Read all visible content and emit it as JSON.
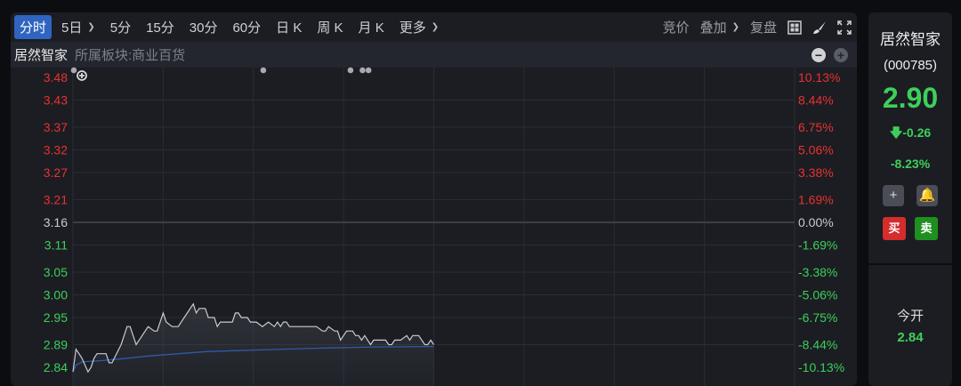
{
  "toolbar": {
    "tabs": [
      "分时",
      "5日",
      "5分",
      "15分",
      "30分",
      "60分",
      "日 K",
      "周 K",
      "月 K",
      "更多"
    ],
    "right": {
      "auction": "竞价",
      "overlay": "叠加",
      "replay": "复盘"
    }
  },
  "subheader": {
    "name": "居然智家",
    "sector": "所属板块:商业百货"
  },
  "axes": {
    "left": [
      "3.48",
      "3.43",
      "3.37",
      "3.32",
      "3.27",
      "3.21",
      "3.16",
      "3.11",
      "3.05",
      "3.00",
      "2.95",
      "2.89",
      "2.84"
    ],
    "right": [
      "10.13%",
      "8.44%",
      "6.75%",
      "5.06%",
      "3.38%",
      "1.69%",
      "0.00%",
      "-1.69%",
      "-3.38%",
      "-5.06%",
      "-6.75%",
      "-8.44%",
      "-10.13%"
    ]
  },
  "chart_data": {
    "type": "line",
    "prev_close": 3.16,
    "ylim": [
      2.84,
      3.48
    ],
    "xlim_minutes": [
      0,
      240
    ],
    "series": [
      {
        "name": "price",
        "color": "#c9cbd0",
        "points": [
          [
            0,
            2.83
          ],
          [
            1,
            2.88
          ],
          [
            2,
            2.87
          ],
          [
            3,
            2.86
          ],
          [
            5,
            2.83
          ],
          [
            6,
            2.84
          ],
          [
            7,
            2.86
          ],
          [
            8,
            2.87
          ],
          [
            11,
            2.87
          ],
          [
            12,
            2.85
          ],
          [
            13,
            2.85
          ],
          [
            16,
            2.89
          ],
          [
            18,
            2.93
          ],
          [
            19,
            2.93
          ],
          [
            21,
            2.89
          ],
          [
            25,
            2.93
          ],
          [
            27,
            2.92
          ],
          [
            28,
            2.92
          ],
          [
            30,
            2.96
          ],
          [
            31,
            2.94
          ],
          [
            33,
            2.93
          ],
          [
            35,
            2.93
          ],
          [
            37,
            2.95
          ],
          [
            40,
            2.98
          ],
          [
            41,
            2.96
          ],
          [
            42,
            2.97
          ],
          [
            44,
            2.97
          ],
          [
            45,
            2.95
          ],
          [
            47,
            2.95
          ],
          [
            48,
            2.93
          ],
          [
            49,
            2.94
          ],
          [
            53,
            2.94
          ],
          [
            54,
            2.96
          ],
          [
            55,
            2.96
          ],
          [
            56,
            2.95
          ],
          [
            58,
            2.95
          ],
          [
            59,
            2.94
          ],
          [
            61,
            2.94
          ],
          [
            63,
            2.93
          ],
          [
            65,
            2.94
          ],
          [
            67,
            2.93
          ],
          [
            68,
            2.94
          ],
          [
            69,
            2.93
          ],
          [
            70,
            2.94
          ],
          [
            71,
            2.94
          ],
          [
            72,
            2.93
          ],
          [
            81,
            2.93
          ],
          [
            83,
            2.92
          ],
          [
            84,
            2.92
          ],
          [
            85,
            2.93
          ],
          [
            87,
            2.92
          ],
          [
            88,
            2.92
          ],
          [
            89,
            2.9
          ],
          [
            91,
            2.92
          ],
          [
            93,
            2.92
          ],
          [
            94,
            2.91
          ],
          [
            95,
            2.91
          ],
          [
            96,
            2.9
          ],
          [
            97,
            2.91
          ],
          [
            99,
            2.89
          ],
          [
            100,
            2.9
          ],
          [
            104,
            2.9
          ],
          [
            105,
            2.89
          ],
          [
            106,
            2.89
          ],
          [
            107,
            2.9
          ],
          [
            109,
            2.9
          ],
          [
            111,
            2.91
          ],
          [
            112,
            2.9
          ],
          [
            113,
            2.91
          ],
          [
            115,
            2.91
          ],
          [
            117,
            2.89
          ],
          [
            118,
            2.89
          ],
          [
            119,
            2.9
          ],
          [
            120,
            2.89
          ]
        ]
      },
      {
        "name": "average",
        "color": "#2f5aa8",
        "points": [
          [
            0,
            2.83
          ],
          [
            1,
            2.845
          ],
          [
            3,
            2.852
          ],
          [
            10,
            2.855
          ],
          [
            18,
            2.86
          ],
          [
            25,
            2.865
          ],
          [
            35,
            2.87
          ],
          [
            45,
            2.875
          ],
          [
            60,
            2.878
          ],
          [
            80,
            2.882
          ],
          [
            100,
            2.885
          ],
          [
            120,
            2.886
          ]
        ]
      }
    ],
    "markers_minutes": [
      0,
      63,
      92,
      96,
      98
    ]
  },
  "quote": {
    "name": "居然智家",
    "code": "(000785)",
    "price": "2.90",
    "change": "-0.26",
    "change_pct": "-8.23%",
    "buy": "买",
    "sell": "卖",
    "open_label": "今开",
    "open": "2.84"
  },
  "colors": {
    "up": "#e8322f",
    "down": "#3ecf5a",
    "neutral": "#c8cad0"
  }
}
